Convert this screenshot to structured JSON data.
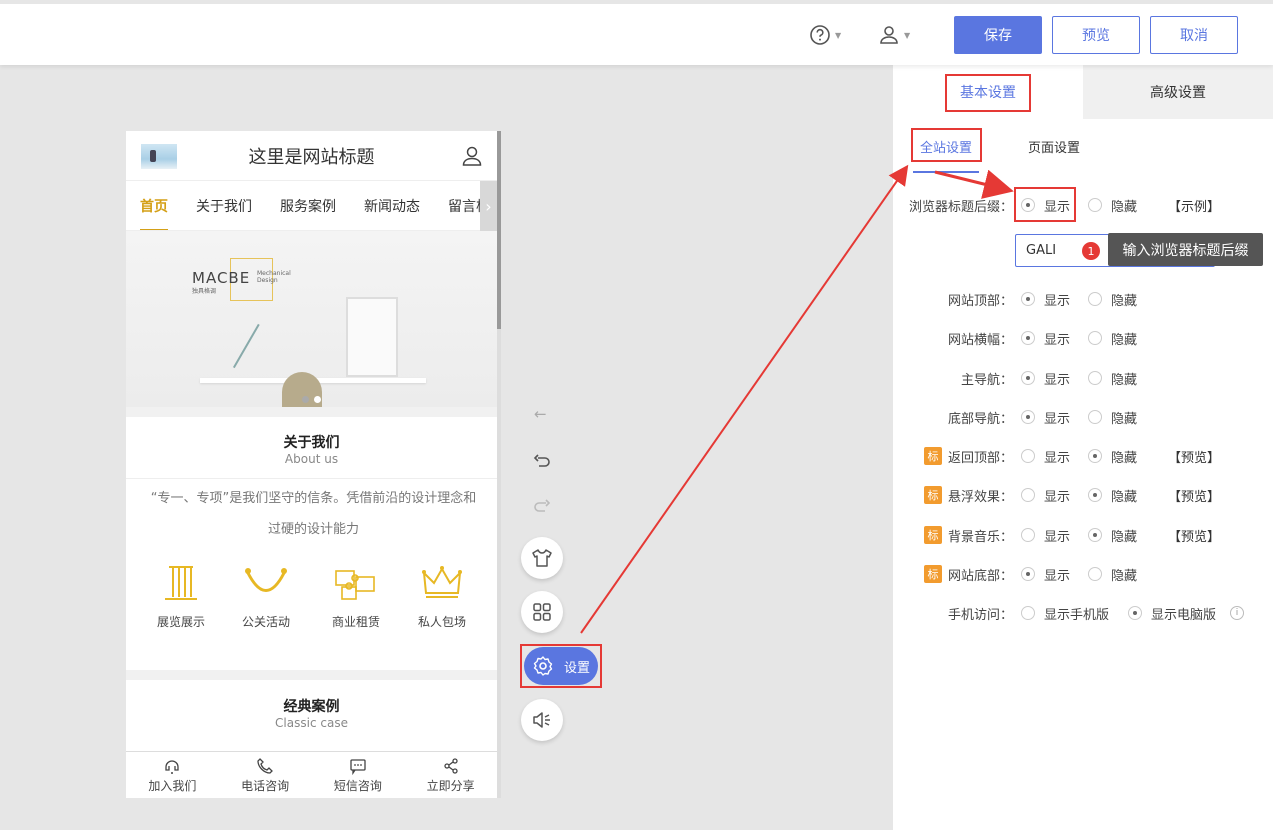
{
  "topbar": {
    "save_label": "保存",
    "preview_label": "预览",
    "cancel_label": "取消",
    "help_icon": "help-icon",
    "user_icon": "user-icon"
  },
  "phone": {
    "site_title": "这里是网站标题",
    "nav": [
      "首页",
      "关于我们",
      "服务案例",
      "新闻动态",
      "留言板"
    ],
    "banner": {
      "brand": "MACBE",
      "brand_sub": "独具格调",
      "brand_tag": "Mechanical Design"
    },
    "about": {
      "title": "关于我们",
      "subtitle": "About us",
      "description": "“专一、专项”是我们坚守的信条。凭借前沿的设计理念和过硬的设计能力"
    },
    "features": [
      "展览展示",
      "公关活动",
      "商业租赁",
      "私人包场"
    ],
    "cases": {
      "title": "经典案例",
      "subtitle": "Classic case"
    },
    "footer": [
      "加入我们",
      "电话咨询",
      "短信咨询",
      "立即分享"
    ]
  },
  "tools": {
    "settings_label": "设置"
  },
  "panel": {
    "tabs": [
      "基本设置",
      "高级设置"
    ],
    "subtabs": [
      "全站设置",
      "页面设置"
    ],
    "option_show": "显示",
    "option_hide": "隐藏",
    "rows": [
      {
        "label": "浏览器标题后缀：",
        "value": "显示",
        "extra": "【示例】"
      },
      {
        "label": "网站顶部：",
        "value": "显示"
      },
      {
        "label": "网站横幅：",
        "value": "显示"
      },
      {
        "label": "主导航：",
        "value": "显示"
      },
      {
        "label": "底部导航：",
        "value": "显示"
      },
      {
        "label": "返回顶部：",
        "value": "隐藏",
        "badge": "标",
        "extra": "【预览】"
      },
      {
        "label": "悬浮效果：",
        "value": "隐藏",
        "badge": "标",
        "extra": "【预览】"
      },
      {
        "label": "背景音乐：",
        "value": "隐藏",
        "badge": "标",
        "extra": "【预览】"
      },
      {
        "label": "网站底部：",
        "value": "显示",
        "badge": "标"
      }
    ],
    "mobile": {
      "label": "手机访问：",
      "opt1": "显示手机版",
      "opt2": "显示电脑版",
      "value": "显示电脑版",
      "info": "i"
    },
    "suffix_input_value": "GALI",
    "tooltip": {
      "number": "1",
      "text": "输入浏览器标题后缀"
    }
  },
  "colors": {
    "accent": "#5a76e0",
    "highlight": "#e53935",
    "brand_gold": "#d4a017",
    "badge": "#f29b2e"
  }
}
